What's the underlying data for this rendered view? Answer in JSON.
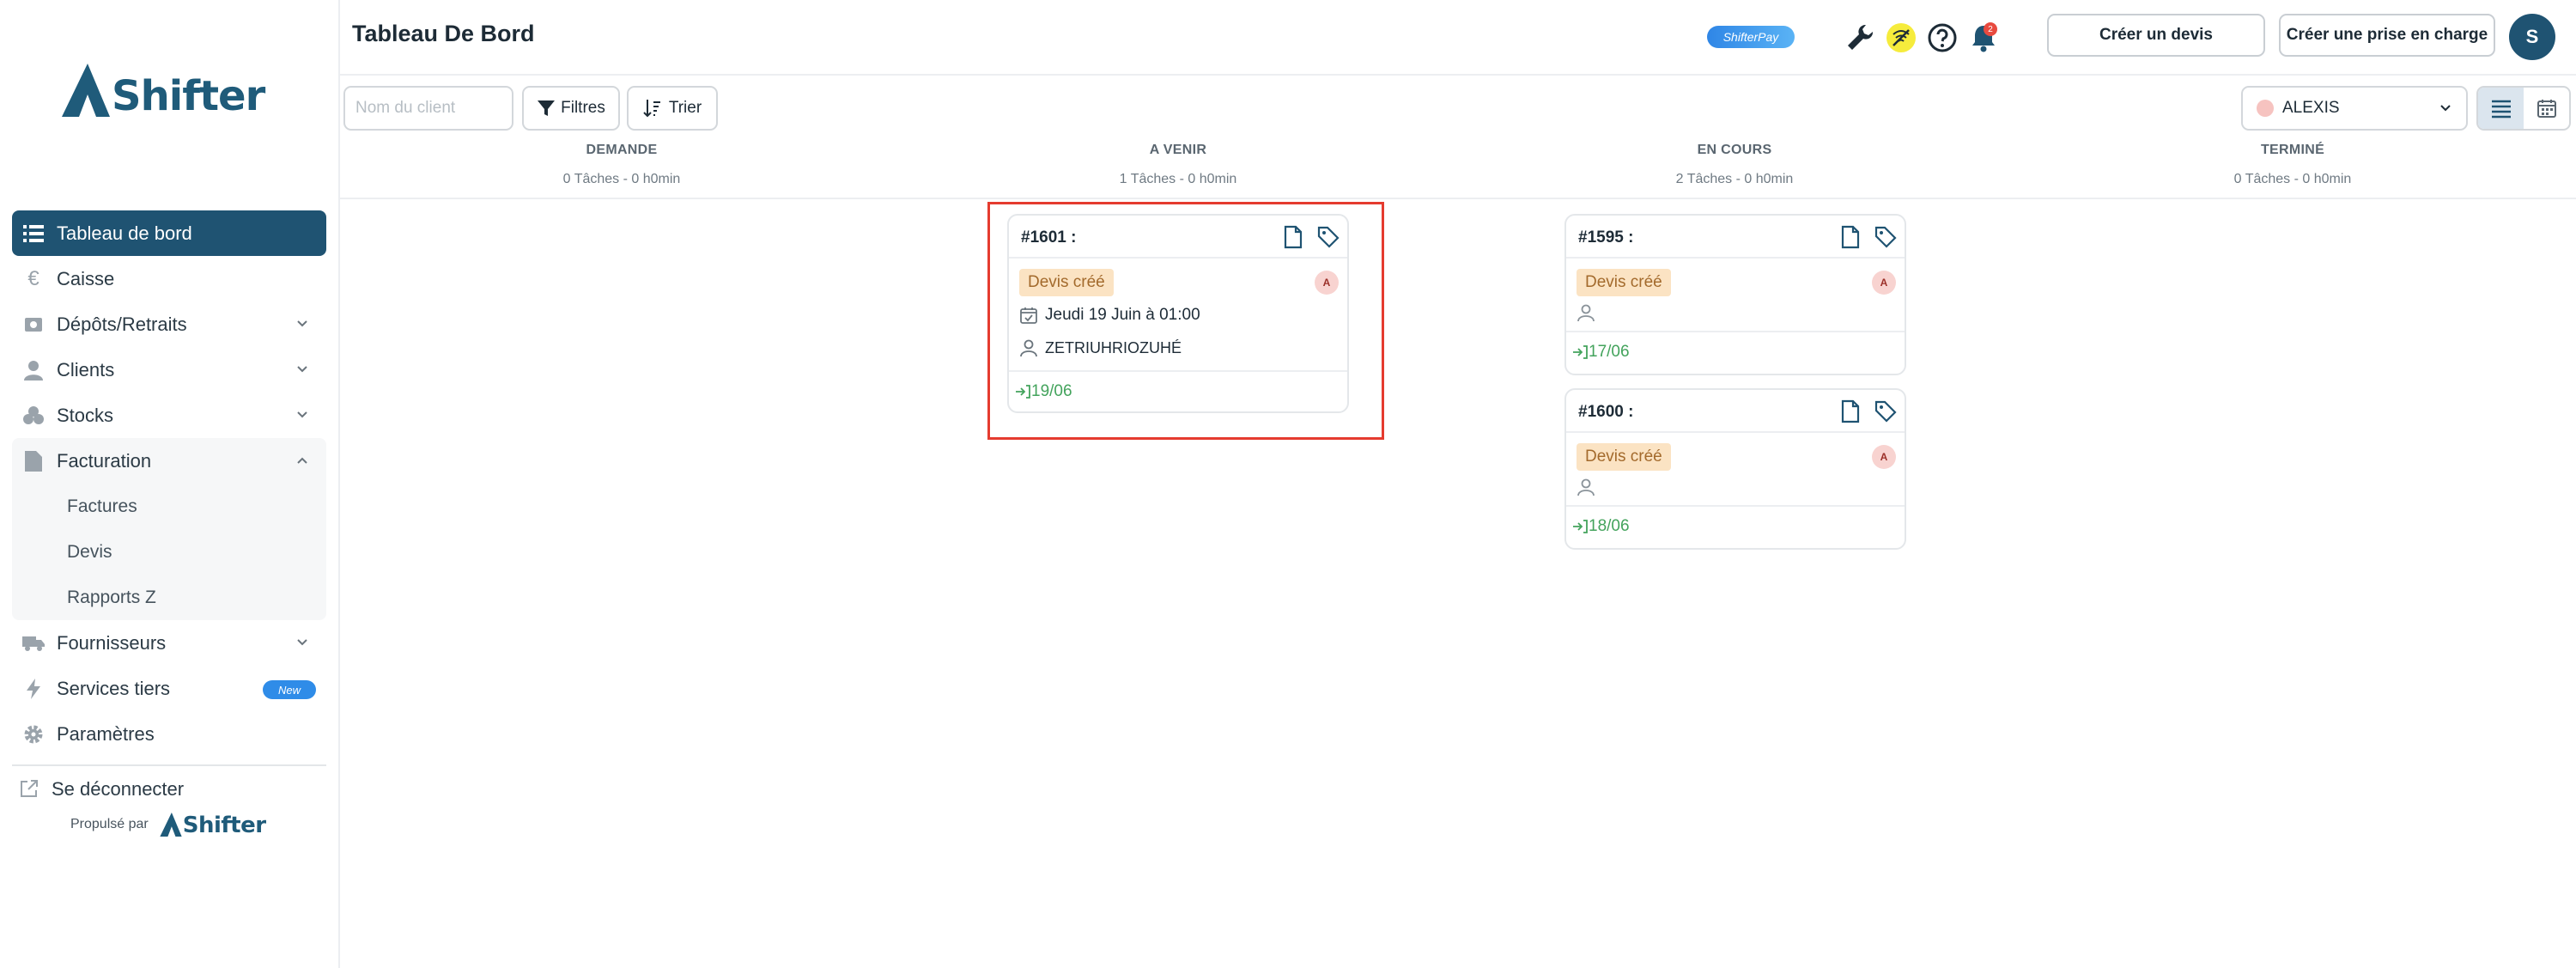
{
  "brand": {
    "name": "Shifter",
    "powered_by": "Propulsé par"
  },
  "sidebar": {
    "items": [
      {
        "label": "Tableau de bord",
        "icon": "list-icon",
        "active": true
      },
      {
        "label": "Caisse",
        "icon": "euro-icon"
      },
      {
        "label": "Dépôts/Retraits",
        "icon": "deposit-icon"
      },
      {
        "label": "Clients",
        "icon": "user-icon"
      },
      {
        "label": "Stocks",
        "icon": "boxes-icon"
      },
      {
        "label": "Facturation",
        "icon": "file-icon"
      },
      {
        "label": "Fournisseurs",
        "icon": "truck-icon"
      },
      {
        "label": "Services tiers",
        "icon": "bolt-icon",
        "badge": "New"
      },
      {
        "label": "Paramètres",
        "icon": "gear-icon"
      }
    ],
    "facturation_sub": [
      "Factures",
      "Devis",
      "Rapports Z"
    ],
    "logout_label": "Se déconnecter"
  },
  "header": {
    "title": "Tableau De Bord",
    "shifterpay_label": "ShifterPay",
    "notification_count": "2",
    "create_quote_label": "Créer un devis",
    "create_intake_label": "Créer une prise en charge",
    "avatar_initial": "S"
  },
  "toolbar": {
    "search_placeholder": "Nom du client",
    "filters_label": "Filtres",
    "sort_label": "Trier",
    "staff_selected": "ALEXIS"
  },
  "columns": [
    {
      "title": "DEMANDE",
      "summary": "0 Tâches - 0 h0min"
    },
    {
      "title": "A VENIR",
      "summary": "1 Tâches - 0 h0min"
    },
    {
      "title": "EN COURS",
      "summary": "2 Tâches - 0 h0min"
    },
    {
      "title": "TERMINÉ",
      "summary": "0 Tâches - 0 h0min"
    }
  ],
  "cards": {
    "c1601": {
      "id": "#1601 :",
      "status": "Devis créé",
      "tech": "A",
      "date": "Jeudi 19 Juin à 01:00",
      "client": "ZETRIUHRIOZUHÉ",
      "due": "19/06"
    },
    "c1595": {
      "id": "#1595 :",
      "status": "Devis créé",
      "tech": "A",
      "due": "17/06"
    },
    "c1600": {
      "id": "#1600 :",
      "status": "Devis créé",
      "tech": "A",
      "due": "18/06"
    }
  },
  "colors": {
    "primary": "#1f5372",
    "accent": "#2f8ce8",
    "status_bg": "#fbe3c3",
    "due_green": "#43a35c",
    "highlight": "#e53b2f"
  }
}
